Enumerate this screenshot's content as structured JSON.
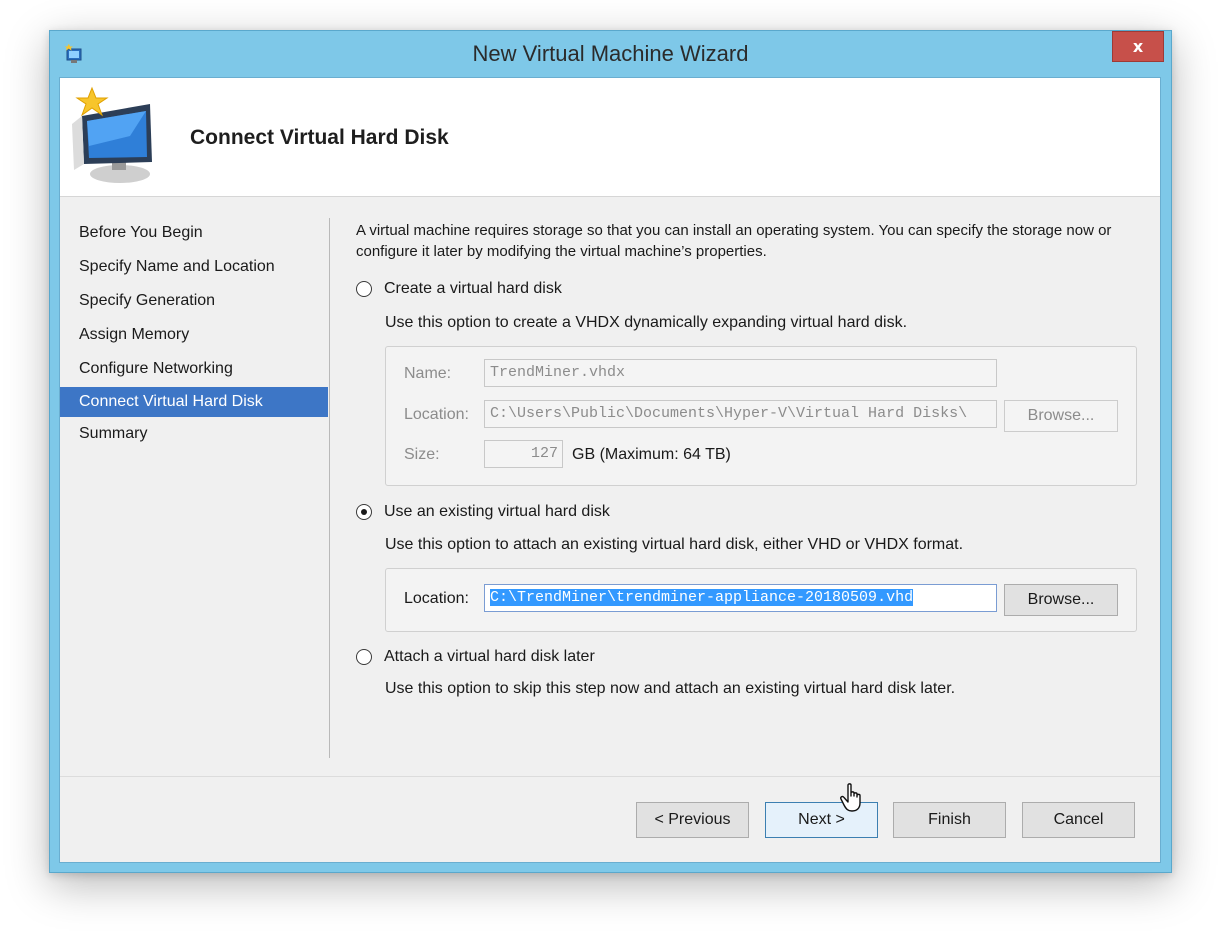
{
  "window": {
    "title": "New Virtual Machine Wizard",
    "close_label": "x"
  },
  "header": {
    "title": "Connect Virtual Hard Disk"
  },
  "nav": {
    "items": [
      {
        "label": "Before You Begin",
        "active": false
      },
      {
        "label": "Specify Name and Location",
        "active": false
      },
      {
        "label": "Specify Generation",
        "active": false
      },
      {
        "label": "Assign Memory",
        "active": false
      },
      {
        "label": "Configure Networking",
        "active": false
      },
      {
        "label": "Connect Virtual Hard Disk",
        "active": true
      },
      {
        "label": "Summary",
        "active": false
      }
    ]
  },
  "content": {
    "description": "A virtual machine requires storage so that you can install an operating system. You can specify the storage now or configure it later by modifying the virtual machine’s properties.",
    "option_create": {
      "label": "Create a virtual hard disk",
      "checked": false,
      "help": "Use this option to create a VHDX dynamically expanding virtual hard disk.",
      "name_label": "Name:",
      "name_value": "TrendMiner.vhdx",
      "location_label": "Location:",
      "location_value": "C:\\Users\\Public\\Documents\\Hyper-V\\Virtual Hard Disks\\",
      "browse_label": "Browse...",
      "size_label": "Size:",
      "size_value": "127",
      "size_suffix": "GB (Maximum: 64 TB)"
    },
    "option_existing": {
      "label": "Use an existing virtual hard disk",
      "checked": true,
      "help": "Use this option to attach an existing virtual hard disk, either VHD or VHDX format.",
      "location_label": "Location:",
      "location_value": "C:\\TrendMiner\\trendminer-appliance-20180509.vhd",
      "browse_label": "Browse..."
    },
    "option_later": {
      "label": "Attach a virtual hard disk later",
      "checked": false,
      "help": "Use this option to skip this step now and attach an existing virtual hard disk later."
    }
  },
  "footer": {
    "previous_label": "< Previous",
    "next_label": "Next >",
    "finish_label": "Finish",
    "cancel_label": "Cancel"
  },
  "colors": {
    "frame": "#7ec8e8",
    "close": "#c7504a",
    "nav_active": "#3d76c6",
    "selection": "#3399ff"
  },
  "icons": [
    "app-icon",
    "close-icon",
    "wizard-monitor-icon",
    "hand-cursor-icon"
  ]
}
